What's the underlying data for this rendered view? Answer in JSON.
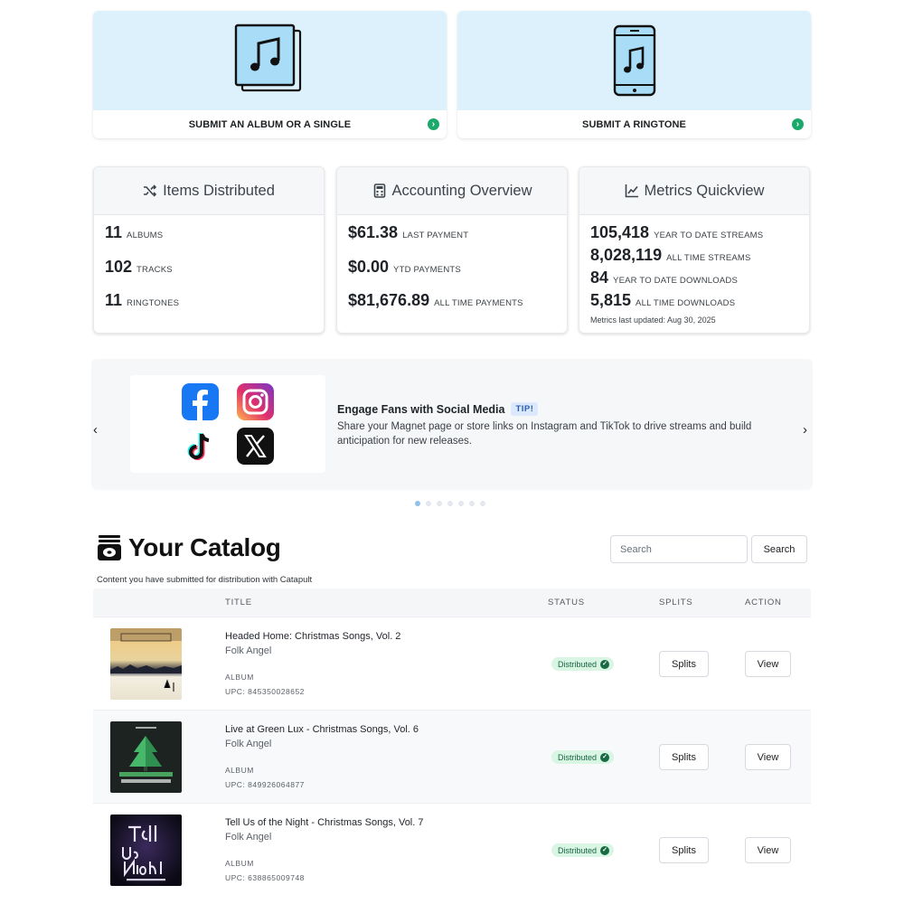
{
  "submit_cards": [
    {
      "label": "SUBMIT AN ALBUM OR A SINGLE",
      "icon": "album-music-icon"
    },
    {
      "label": "SUBMIT A RINGTONE",
      "icon": "phone-music-icon"
    }
  ],
  "stats": {
    "items": {
      "title": "Items Distributed",
      "rows": [
        {
          "value": "11",
          "unit": "ALBUMS"
        },
        {
          "value": "102",
          "unit": "TRACKS"
        },
        {
          "value": "11",
          "unit": "RINGTONES"
        }
      ]
    },
    "accounting": {
      "title": "Accounting Overview",
      "rows": [
        {
          "value": "$61.38",
          "unit": "LAST PAYMENT"
        },
        {
          "value": "$0.00",
          "unit": "YTD PAYMENTS"
        },
        {
          "value": "$81,676.89",
          "unit": "ALL TIME PAYMENTS"
        }
      ]
    },
    "metrics": {
      "title": "Metrics Quickview",
      "rows": [
        {
          "value": "105,418",
          "unit": "YEAR TO DATE STREAMS"
        },
        {
          "value": "8,028,119",
          "unit": "ALL TIME STREAMS"
        },
        {
          "value": "84",
          "unit": "YEAR TO DATE DOWNLOADS"
        },
        {
          "value": "5,815",
          "unit": "ALL TIME DOWNLOADS"
        }
      ],
      "note": "Metrics last updated: Aug 30, 2025"
    }
  },
  "carousel": {
    "title": "Engage Fans with Social Media",
    "tip": "TIP!",
    "body": "Share your Magnet page or store links on Instagram and TikTok to drive streams and build anticipation for new releases.",
    "prev": "‹",
    "next": "›",
    "dots_total": 7,
    "active_dot": 1
  },
  "catalog": {
    "title": "Your Catalog",
    "subtitle": "Content you have submitted for distribution with Catapult",
    "search_placeholder": "Search",
    "search_button": "Search",
    "columns": {
      "title": "TITLE",
      "status": "STATUS",
      "splits": "SPLITS",
      "action": "ACTION"
    },
    "rows": [
      {
        "title": "Headed Home: Christmas Songs, Vol. 2",
        "artist": "Folk Angel",
        "type": "ALBUM",
        "upc": "UPC: 845350028652",
        "status": "Distributed",
        "splits": "Splits",
        "action": "View"
      },
      {
        "title": "Live at Green Lux - Christmas Songs, Vol. 6",
        "artist": "Folk Angel",
        "type": "ALBUM",
        "upc": "UPC: 849926064877",
        "status": "Distributed",
        "splits": "Splits",
        "action": "View"
      },
      {
        "title": "Tell Us of the Night - Christmas Songs, Vol. 7",
        "artist": "Folk Angel",
        "type": "ALBUM",
        "upc": "UPC: 638865009748",
        "status": "Distributed",
        "splits": "Splits",
        "action": "View"
      }
    ]
  },
  "colors": {
    "accent_light": "#dcf1fc",
    "success": "#1aa96a",
    "badge_bg": "#d9f5e4"
  }
}
